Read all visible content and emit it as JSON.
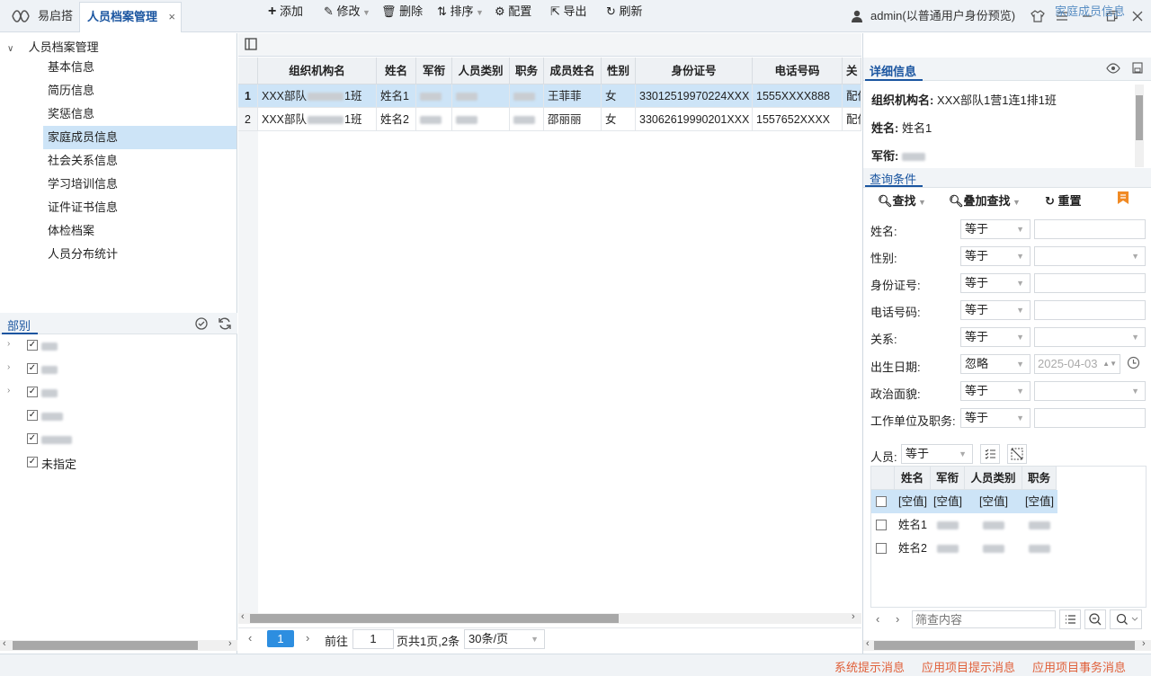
{
  "app": {
    "name": "易启搭"
  },
  "tabs": [
    {
      "label": "人员档案管理",
      "close": "×"
    }
  ],
  "user": {
    "label": "admin(以普通用户身份预览)"
  },
  "colors": {
    "accent": "#1a55a0",
    "selected": "#cde4f7",
    "pager_active": "#2d8ee0",
    "status": "#e0603a",
    "bookmark": "#f08a24"
  },
  "nav": {
    "root": "人员档案管理",
    "items": [
      "基本信息",
      "简历信息",
      "奖惩信息",
      "家庭成员信息",
      "社会关系信息",
      "学习培训信息",
      "证件证书信息",
      "体检档案",
      "人员分布统计"
    ],
    "selected_index": 3
  },
  "dept": {
    "title": "部别",
    "items": [
      {
        "label": "",
        "expandable": true
      },
      {
        "label": "",
        "expandable": true
      },
      {
        "label": "",
        "expandable": true
      },
      {
        "label": "",
        "expandable": false
      },
      {
        "label": "",
        "expandable": false
      },
      {
        "label": "未指定",
        "expandable": false
      }
    ]
  },
  "toolbar": {
    "add": "添加",
    "edit": "修改",
    "delete": "删除",
    "sort": "排序",
    "config": "配置",
    "export": "导出",
    "refresh": "刷新",
    "context": "家庭成员信息"
  },
  "table": {
    "columns": [
      "组织机构名",
      "姓名",
      "军衔",
      "人员类别",
      "职务",
      "成员姓名",
      "性别",
      "身份证号",
      "电话号码",
      "关"
    ],
    "rows": [
      {
        "num": "1",
        "org": "XXX部队",
        "org_suffix": "1班",
        "name": "姓名1",
        "member": "王菲菲",
        "gender": "女",
        "id": "33012519970224XXX",
        "phone": "1555XXXX888",
        "rel": "配偶"
      },
      {
        "num": "2",
        "org": "XXX部队",
        "org_suffix": "1班",
        "name": "姓名2",
        "member": "邵丽丽",
        "gender": "女",
        "id": "33062619990201XXX",
        "phone": "1557652XXXX",
        "rel": "配偶"
      }
    ]
  },
  "pager": {
    "page": "1",
    "goto": "前往",
    "goto_value": "1",
    "summary": "页共1页,2条",
    "page_size": "30条/页"
  },
  "detail": {
    "title": "详细信息",
    "fields": [
      {
        "label": "组织机构名:",
        "value": "XXX部队1营1连1排1班"
      },
      {
        "label": "姓名:",
        "value": "姓名1"
      },
      {
        "label": "军衔:",
        "value": ""
      }
    ]
  },
  "query": {
    "title": "查询条件",
    "find": "查找",
    "add_find": "叠加查找",
    "reset": "重置",
    "fields": [
      {
        "label": "姓名:",
        "op": "等于",
        "value": "",
        "dropdown": false
      },
      {
        "label": "性别:",
        "op": "等于",
        "value": "",
        "dropdown": true
      },
      {
        "label": "身份证号:",
        "op": "等于",
        "value": "",
        "dropdown": false
      },
      {
        "label": "电话号码:",
        "op": "等于",
        "value": "",
        "dropdown": false
      },
      {
        "label": "关系:",
        "op": "等于",
        "value": "",
        "dropdown": true
      },
      {
        "label": "出生日期:",
        "op": "忽略",
        "value": "2025-04-03",
        "dropdown": false,
        "date": true
      },
      {
        "label": "政治面貌:",
        "op": "等于",
        "value": "",
        "dropdown": true
      },
      {
        "label": "工作单位及职务:",
        "op": "等于",
        "value": "",
        "dropdown": false
      }
    ],
    "person": {
      "label": "人员:",
      "op": "等于"
    },
    "person_table": {
      "columns": [
        "姓名",
        "军衔",
        "人员类别",
        "职务"
      ],
      "rows": [
        {
          "name": "[空值]",
          "rank": "[空值]",
          "type": "[空值]",
          "duty": "[空值]"
        },
        {
          "name": "姓名1",
          "rank": "",
          "type": "",
          "duty": ""
        },
        {
          "name": "姓名2",
          "rank": "",
          "type": "",
          "duty": ""
        }
      ]
    },
    "filter_placeholder": "筛查内容"
  },
  "status": {
    "sys": "系统提示消息",
    "app": "应用项目提示消息",
    "task": "应用项目事务消息"
  }
}
